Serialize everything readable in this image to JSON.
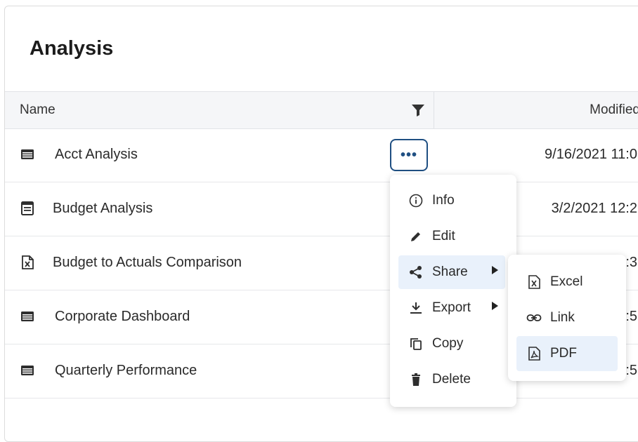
{
  "page": {
    "title": "Analysis"
  },
  "table": {
    "columns": {
      "name": "Name",
      "modified": "Modified"
    },
    "rows": [
      {
        "name": "Acct Analysis",
        "modified": "9/16/2021 11:0",
        "icon": "dashboard-icon"
      },
      {
        "name": "Budget Analysis",
        "modified": "3/2/2021 12:2",
        "icon": "report-icon"
      },
      {
        "name": "Budget to Actuals Comparison",
        "modified": ":3",
        "icon": "excel-file-icon"
      },
      {
        "name": "Corporate Dashboard",
        "modified": ":5",
        "icon": "dashboard-icon"
      },
      {
        "name": "Quarterly Performance",
        "modified": ":5",
        "icon": "dashboard-icon"
      }
    ]
  },
  "row_actions": {
    "more_label": "•••"
  },
  "menu": {
    "items": [
      {
        "label": "Info",
        "icon": "info-icon"
      },
      {
        "label": "Edit",
        "icon": "pencil-icon"
      },
      {
        "label": "Share",
        "icon": "share-icon"
      },
      {
        "label": "Export",
        "icon": "download-icon"
      },
      {
        "label": "Copy",
        "icon": "copy-icon"
      },
      {
        "label": "Delete",
        "icon": "trash-icon"
      }
    ]
  },
  "submenu": {
    "items": [
      {
        "label": "Excel",
        "icon": "excel-icon"
      },
      {
        "label": "Link",
        "icon": "link-icon"
      },
      {
        "label": "PDF",
        "icon": "pdf-icon"
      }
    ]
  },
  "colors": {
    "accent": "#1f4f82",
    "highlight": "#e9f1fb",
    "header_bg": "#f5f6f8"
  }
}
